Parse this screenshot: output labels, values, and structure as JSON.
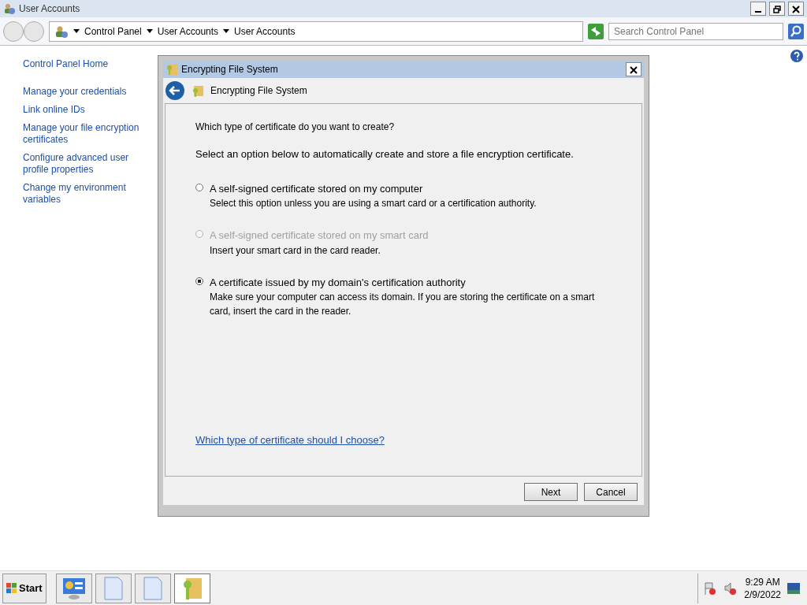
{
  "window": {
    "title": "User Accounts"
  },
  "address_bar": {
    "breadcrumbs": [
      "Control Panel",
      "User Accounts",
      "User Accounts"
    ]
  },
  "search": {
    "placeholder": "Search Control Panel"
  },
  "sidebar": {
    "items": [
      "Control Panel Home",
      "Manage your credentials",
      "Link online IDs",
      "Manage your file encryption certificates",
      "Configure advanced user profile properties",
      "Change my environment variables"
    ]
  },
  "dialog": {
    "title": "Encrypting File System",
    "header": "Encrypting File System",
    "question": "Which type of certificate do you want to create?",
    "instruction": "Select an option below to automatically create and store a file encryption certificate.",
    "options": [
      {
        "label": "A self-signed certificate stored on my computer",
        "description": "Select this option unless you are using a smart card or a certification authority.",
        "selected": false,
        "disabled": false
      },
      {
        "label": "A self-signed certificate stored on my smart card",
        "description": "Insert your smart card in the card reader.",
        "selected": false,
        "disabled": true
      },
      {
        "label": "A certificate issued by my domain's certification authority",
        "description": "Make sure your computer can access its domain. If you are storing the certificate on a smart card, insert the card in the reader.",
        "selected": true,
        "disabled": false
      }
    ],
    "help_link": "Which type of certificate should I choose?",
    "buttons": [
      "Next",
      "Cancel"
    ]
  },
  "taskbar": {
    "start": "Start",
    "apps": [
      {
        "kind": "control-panel",
        "selected": false
      },
      {
        "kind": "document",
        "selected": false
      },
      {
        "kind": "document",
        "selected": false
      },
      {
        "kind": "key-folder",
        "selected": true
      }
    ],
    "clock": {
      "time": "9:29 AM",
      "date": "2/9/2022"
    }
  }
}
